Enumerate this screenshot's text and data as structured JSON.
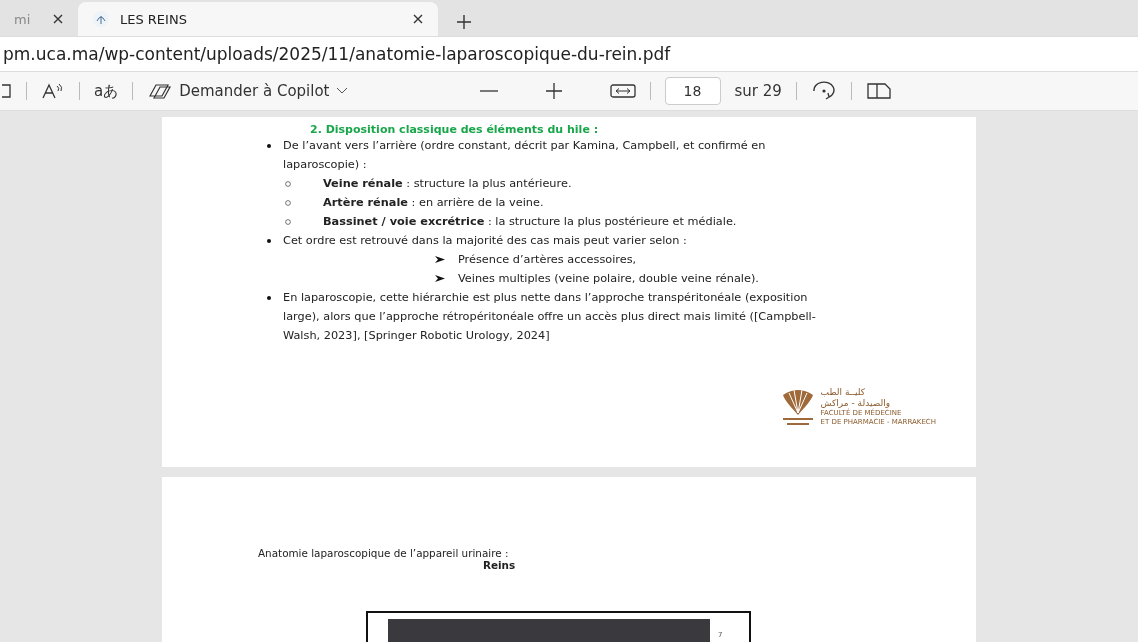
{
  "tabs": [
    {
      "title": "mi",
      "selected": false
    },
    {
      "title": "LES REINS",
      "selected": true
    }
  ],
  "address_bar": {
    "url": "pm.uca.ma/wp-content/uploads/2025/11/anatomie-laparoscopique-du-rein.pdf"
  },
  "toolbar": {
    "translate_label": "aあ",
    "copilot_label": "Demander à Copilot",
    "page_number": "18",
    "page_total": "sur 29"
  },
  "page_1": {
    "heading": "2.   Disposition classique des éléments du hile :",
    "items": [
      {
        "kind": "bullet",
        "text": "De l’avant vers l’arrière (ordre constant, décrit par Kamina, Campbell, et confirmé en laparoscopie) :"
      },
      {
        "kind": "circle",
        "text": "**Veine rénale** : structure la plus antérieure."
      },
      {
        "kind": "circle",
        "text": "**Artère rénale** : en arrière de la veine."
      },
      {
        "kind": "circle",
        "text": "**Bassinet / voie excrétrice** : la structure la plus postérieure et médiale."
      },
      {
        "kind": "bullet",
        "text": "Cet ordre est retrouvé dans la majorité des cas mais peut varier selon :"
      },
      {
        "kind": "arrow",
        "text": "Présence d’artères accessoires,"
      },
      {
        "kind": "arrow",
        "text": "Veines multiples (veine polaire, double veine rénale)."
      },
      {
        "kind": "bullet",
        "text": "En laparoscopie, cette hiérarchie est plus nette dans l’approche transpéritonéale (exposition large), alors que l’approche rétropéritonéale offre un accès plus direct mais limité ([Campbell-Walsh, 2023], [Springer Robotic Urology, 2024]"
      }
    ],
    "logo": {
      "arabic_lines": [
        "كليــة الطب",
        "والصيدلة - مراكش"
      ],
      "latin_lines": [
        "FACULTÉ DE MÉDECINE",
        "ET DE PHARMACIE - MARRAKECH"
      ]
    }
  },
  "page_2": {
    "title": "Anatomie laparoscopique de l’appareil urinaire :",
    "subtitle": "Reins",
    "figure_labels": [
      "7"
    ]
  }
}
